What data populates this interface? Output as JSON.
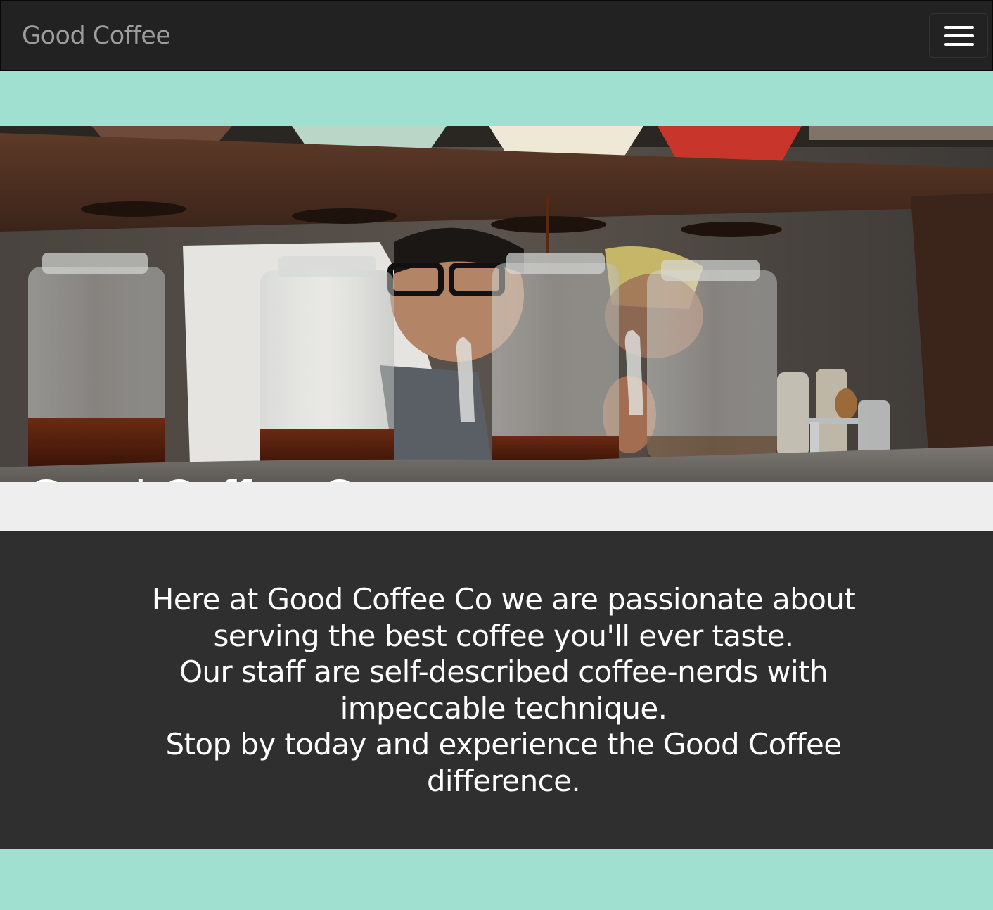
{
  "navbar": {
    "brand": "Good Coffee",
    "toggle_icon": "hamburger-menu-icon"
  },
  "hero": {
    "title": "Good Coffee Co."
  },
  "about": {
    "lines": [
      "Here at Good Coffee Co we are passionate about serving the best coffee you'll ever taste.",
      "Our staff are self-described coffee-nerds with impeccable technique.",
      "Stop by today and experience the Good Coffee difference."
    ]
  },
  "colors": {
    "navbar_bg": "#222222",
    "brand_text": "#9d9d9d",
    "accent_band": "#9fe0d0",
    "light_band": "#eeeeee",
    "about_bg": "#2f2f2f",
    "about_text": "#ffffff"
  }
}
